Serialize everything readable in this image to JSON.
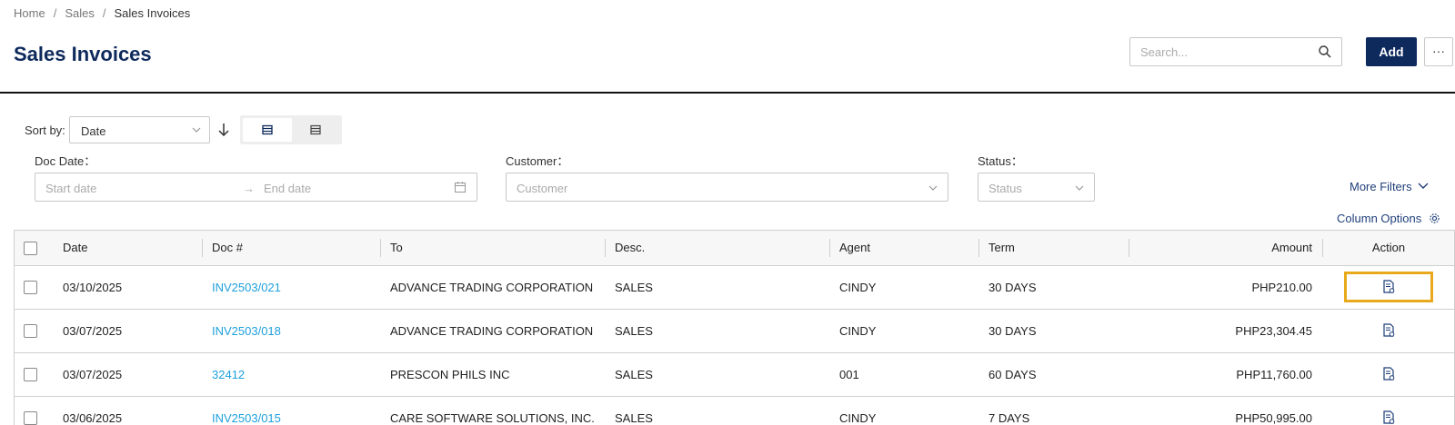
{
  "breadcrumb": {
    "items": [
      "Home",
      "Sales",
      "Sales Invoices"
    ],
    "separator": "/"
  },
  "page": {
    "title": "Sales Invoices"
  },
  "header": {
    "search_placeholder": "Search...",
    "add_label": "Add",
    "more_label": "···"
  },
  "toolbar": {
    "sort_label": "Sort by:",
    "sort_value": "Date"
  },
  "filters": {
    "doc_date_label": "Doc Date：",
    "start_placeholder": "Start date",
    "range_arrow": "→",
    "end_placeholder": "End date",
    "customer_label": "Customer：",
    "customer_placeholder": "Customer",
    "status_label": "Status：",
    "status_placeholder": "Status",
    "more_filters_label": "More Filters",
    "column_options_label": "Column Options"
  },
  "table": {
    "columns": {
      "date": "Date",
      "doc": "Doc #",
      "to": "To",
      "desc": "Desc.",
      "agent": "Agent",
      "term": "Term",
      "amount": "Amount",
      "action": "Action"
    },
    "rows": [
      {
        "date": "03/10/2025",
        "doc": "INV2503/021",
        "to": "ADVANCE TRADING CORPORATION",
        "desc": "SALES",
        "agent": "CINDY",
        "term": "30 DAYS",
        "amount": "PHP210.00"
      },
      {
        "date": "03/07/2025",
        "doc": "INV2503/018",
        "to": "ADVANCE TRADING CORPORATION",
        "desc": "SALES",
        "agent": "CINDY",
        "term": "30 DAYS",
        "amount": "PHP23,304.45"
      },
      {
        "date": "03/07/2025",
        "doc": "32412",
        "to": "PRESCON PHILS INC",
        "desc": "SALES",
        "agent": "001",
        "term": "60 DAYS",
        "amount": "PHP11,760.00"
      },
      {
        "date": "03/06/2025",
        "doc": "INV2503/015",
        "to": "CARE SOFTWARE SOLUTIONS, INC.",
        "desc": "SALES",
        "agent": "CINDY",
        "term": "7 DAYS",
        "amount": "PHP50,995.00"
      }
    ]
  },
  "colors": {
    "brand_navy": "#0e2a5c",
    "link_blue": "#1ea0dc",
    "highlight": "#e8a91c"
  },
  "icons": [
    "search-icon",
    "chevron-down-icon",
    "arrow-down-icon",
    "card-view-icon",
    "list-view-icon",
    "calendar-icon",
    "gear-icon",
    "document-view-icon"
  ]
}
